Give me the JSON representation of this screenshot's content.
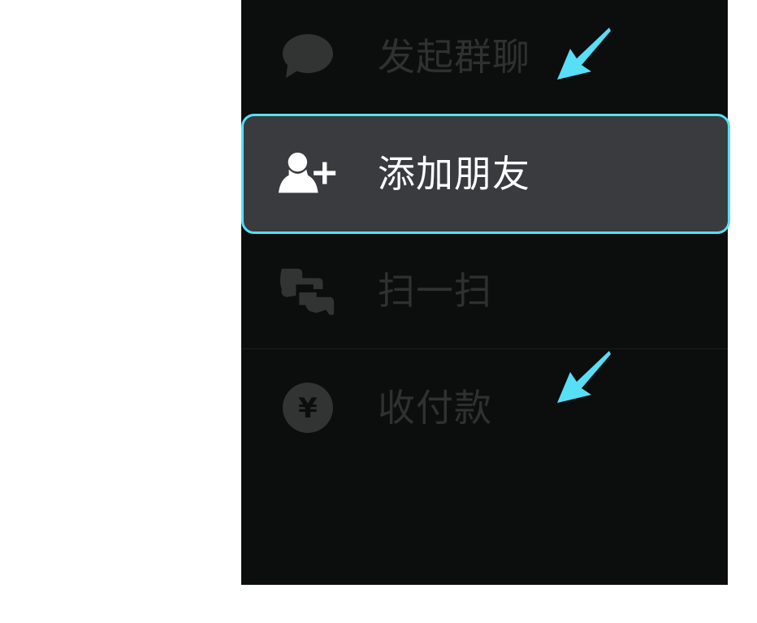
{
  "menu": {
    "items": [
      {
        "label": "发起群聊",
        "icon": "chat-bubble-icon",
        "highlighted": false
      },
      {
        "label": "添加朋友",
        "icon": "add-friend-icon",
        "highlighted": true
      },
      {
        "label": "扫一扫",
        "icon": "scan-icon",
        "highlighted": false
      },
      {
        "label": "收付款",
        "icon": "yuan-payment-icon",
        "highlighted": false
      }
    ],
    "yuan_symbol": "¥"
  },
  "colors": {
    "panel_background": "#0c0d0d",
    "highlight_background": "#3a3b3e",
    "highlight_border": "#56dff7",
    "dim_text": "#2f3131",
    "active_text": "#ffffff",
    "annotation_arrow": "#56dff7"
  },
  "annotations": {
    "arrows": [
      "arrow-pointer-icon",
      "arrow-pointer-icon"
    ]
  }
}
